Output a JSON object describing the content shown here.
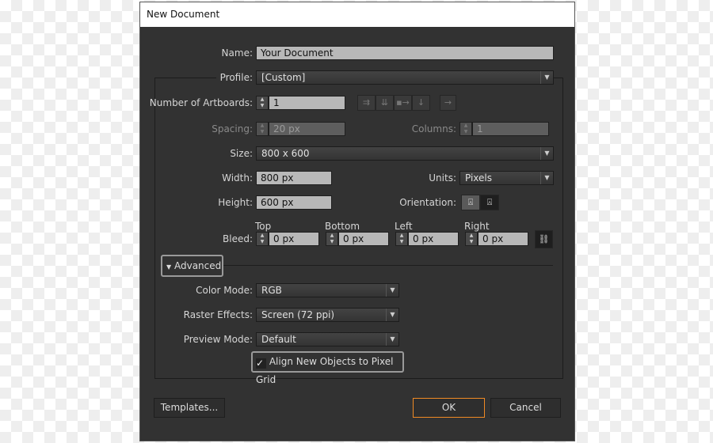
{
  "dialog": {
    "title": "New Document"
  },
  "name": {
    "label": "Name:",
    "value": "Your Document"
  },
  "profile": {
    "label": "Profile:",
    "value": "[Custom]"
  },
  "artboards": {
    "label": "Number of Artboards:",
    "value": "1",
    "layout_icons": [
      "grid-by-row-icon",
      "grid-by-column-icon",
      "arrange-by-row-icon",
      "arrange-by-column-icon",
      "right-to-left-icon"
    ]
  },
  "spacing": {
    "label": "Spacing:",
    "value": "20 px"
  },
  "columns": {
    "label": "Columns:",
    "value": "1"
  },
  "size": {
    "label": "Size:",
    "value": "800 x 600"
  },
  "width": {
    "label": "Width:",
    "value": "800 px"
  },
  "units": {
    "label": "Units:",
    "value": "Pixels"
  },
  "height": {
    "label": "Height:",
    "value": "600 px"
  },
  "orientation": {
    "label": "Orientation:",
    "selected": "landscape"
  },
  "bleed": {
    "label": "Bleed:",
    "top_label": "Top",
    "top": "0 px",
    "bottom_label": "Bottom",
    "bottom": "0 px",
    "left_label": "Left",
    "left": "0 px",
    "right_label": "Right",
    "right": "0 px"
  },
  "advanced": {
    "label": "Advanced",
    "expanded": true
  },
  "color_mode": {
    "label": "Color Mode:",
    "value": "RGB"
  },
  "raster": {
    "label": "Raster Effects:",
    "value": "Screen (72 ppi)"
  },
  "preview": {
    "label": "Preview Mode:",
    "value": "Default"
  },
  "align": {
    "label": "Align New Objects to Pixel Grid",
    "checked": true
  },
  "buttons": {
    "templates": "Templates...",
    "ok": "OK",
    "cancel": "Cancel"
  },
  "colors": {
    "accent": "#f08a24",
    "panel": "#323232"
  }
}
